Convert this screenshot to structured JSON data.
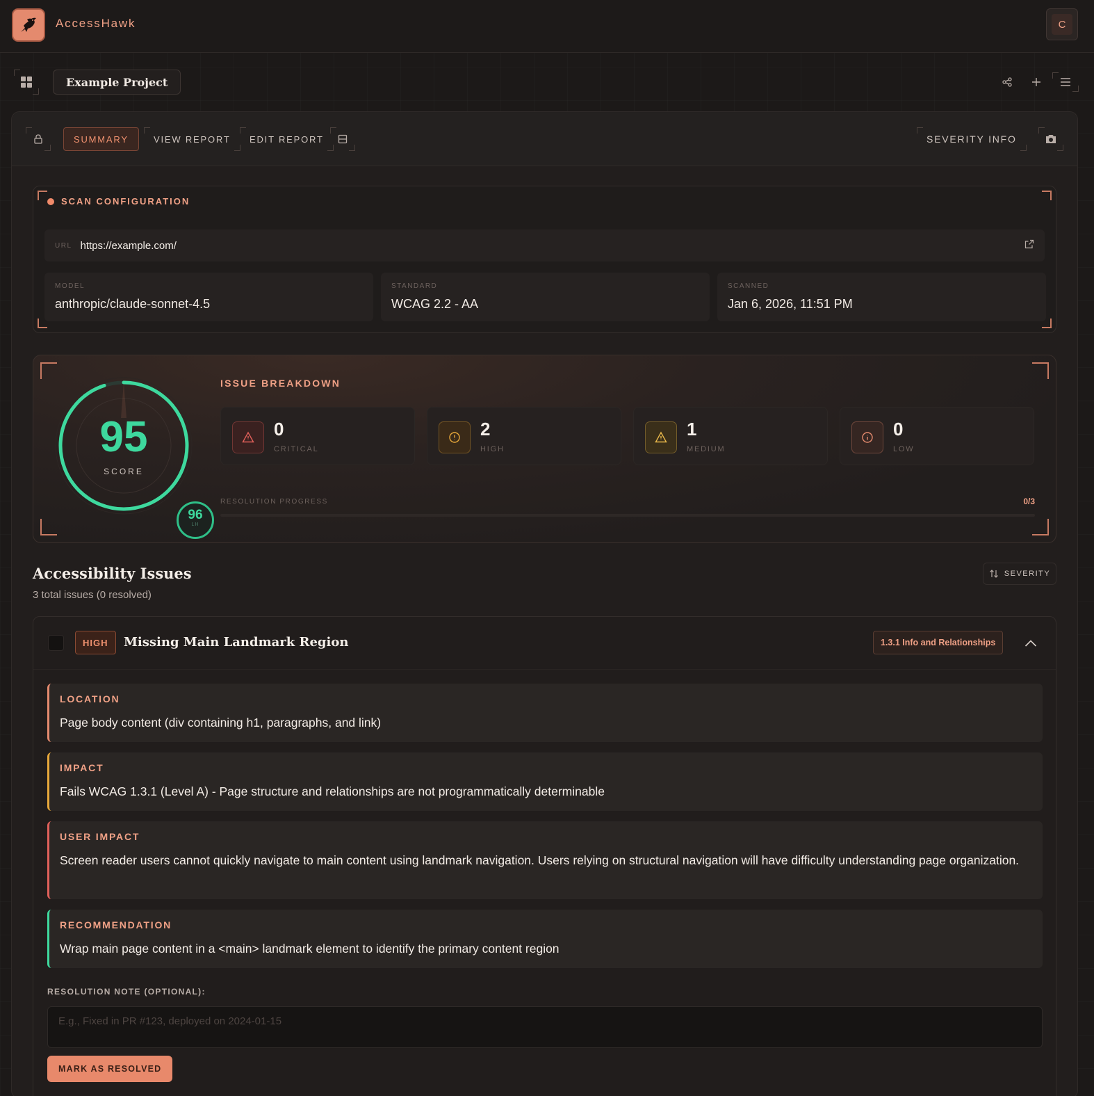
{
  "app": {
    "name": "AccessHawk",
    "avatar_initial": "C"
  },
  "project": {
    "name": "Example Project"
  },
  "tabs": {
    "summary": "SUMMARY",
    "view_report": "VIEW REPORT",
    "edit_report": "EDIT REPORT",
    "severity_info": "SEVERITY INFO"
  },
  "scan_config": {
    "title": "SCAN CONFIGURATION",
    "url_label": "URL",
    "url": "https://example.com/",
    "model_label": "MODEL",
    "model": "anthropic/claude-sonnet-4.5",
    "standard_label": "STANDARD",
    "standard": "WCAG 2.2 - AA",
    "scanned_label": "SCANNED",
    "scanned": "Jan 6, 2026, 11:51 PM"
  },
  "score": {
    "value": "95",
    "label": "SCORE",
    "fraction": 0.95,
    "lighthouse": "96",
    "lighthouse_label": "LH"
  },
  "breakdown": {
    "title": "ISSUE BREAKDOWN",
    "items": [
      {
        "count": "0",
        "label": "CRITICAL",
        "icon": "alert-triangle-icon",
        "color": "#e0605a",
        "bg": "#3a2120"
      },
      {
        "count": "2",
        "label": "HIGH",
        "icon": "alert-circle-icon",
        "color": "#e8a83a",
        "bg": "#3a2a18"
      },
      {
        "count": "1",
        "label": "MEDIUM",
        "icon": "alert-triangle-icon",
        "color": "#e8b84a",
        "bg": "#3a2f1a"
      },
      {
        "count": "0",
        "label": "LOW",
        "icon": "info-icon",
        "color": "#e48a6e",
        "bg": "#352622"
      }
    ],
    "progress_label": "RESOLUTION PROGRESS",
    "progress_value": "0/3",
    "progress_fraction": 0
  },
  "issues": {
    "title": "Accessibility Issues",
    "subtitle": "3 total issues (0 resolved)",
    "sort_label": "SEVERITY",
    "list": [
      {
        "severity": "HIGH",
        "title": "Missing Main Landmark Region",
        "criterion": "1.3.1 Info and Relationships",
        "location_label": "LOCATION",
        "location": "Page body content (div containing h1, paragraphs, and link)",
        "impact_label": "IMPACT",
        "impact": "Fails WCAG 1.3.1 (Level A) - Page structure and relationships are not programmatically determinable",
        "user_impact_label": "USER IMPACT",
        "user_impact": "Screen reader users cannot quickly navigate to main content using landmark navigation. Users relying on structural navigation will have difficulty understanding page organization.",
        "recommendation_label": "RECOMMENDATION",
        "recommendation": "Wrap main page content in a <main> landmark element to identify the primary content region",
        "note_label": "RESOLUTION NOTE (OPTIONAL):",
        "note_placeholder": "E.g., Fixed in PR #123, deployed on 2024-01-15",
        "resolve_label": "MARK AS RESOLVED"
      }
    ]
  },
  "colors": {
    "accent": "#e8896b",
    "score_green": "#3ed99e",
    "background": "#1c1918"
  }
}
